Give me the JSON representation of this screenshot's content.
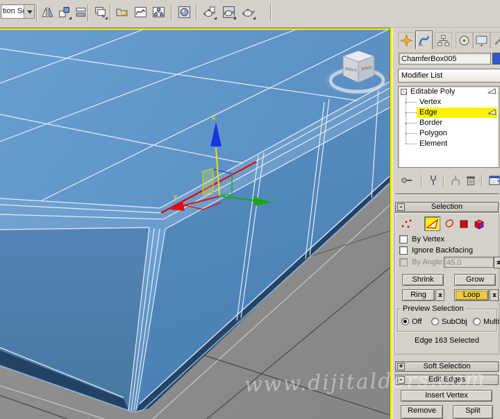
{
  "toolbar": {
    "selection_set_value": "tion Se",
    "icons": [
      {
        "name": "mirror-icon"
      },
      {
        "name": "align-icon"
      },
      {
        "name": "manage-layers-icon"
      },
      {
        "name": "layer-list-icon"
      },
      {
        "name": "scene-explorer-icon"
      },
      {
        "name": "curve-editor-icon"
      },
      {
        "name": "schematic-view-icon"
      },
      {
        "name": "material-editor-icon"
      },
      {
        "name": "render-setup-icon"
      },
      {
        "name": "rendered-frame-window-icon"
      },
      {
        "name": "render-production-icon"
      }
    ]
  },
  "viewport": {
    "watermark": "www.dijitalders.com",
    "axis_labels": {
      "x": "x",
      "y": "y",
      "z": "z"
    },
    "viewcube": {
      "left_face": "RIGHT",
      "right_face": "BACK"
    }
  },
  "command_panel": {
    "tabs": [
      {
        "name": "create-tab"
      },
      {
        "name": "modify-tab"
      },
      {
        "name": "hierarchy-tab"
      },
      {
        "name": "motion-tab"
      },
      {
        "name": "display-tab"
      },
      {
        "name": "utilities-tab"
      }
    ],
    "object_name": "ChamferBox005",
    "object_color": "#2e59cf",
    "modifier_list_label": "Modifier List",
    "modifier_stack": {
      "expand_glyph": "-",
      "items": [
        {
          "label": "Editable Poly"
        },
        {
          "label": "Vertex"
        },
        {
          "label": "Edge"
        },
        {
          "label": "Border"
        },
        {
          "label": "Polygon"
        },
        {
          "label": "Element"
        }
      ]
    },
    "stack_tools": [
      {
        "name": "pin-stack-icon"
      },
      {
        "name": "show-end-result-icon"
      },
      {
        "name": "make-unique-icon"
      },
      {
        "name": "remove-modifier-icon"
      },
      {
        "name": "configure-modifier-sets-icon"
      }
    ],
    "selection": {
      "title": "Selection",
      "collapse": "-",
      "by_vertex": "By Vertex",
      "ignore_backfacing": "Ignore Backfacing",
      "by_angle": "By Angle:",
      "by_angle_value": "45,0",
      "shrink": "Shrink",
      "grow": "Grow",
      "ring": "Ring",
      "loop": "Loop",
      "preview_label": "Preview Selection",
      "off": "Off",
      "subobj": "SubObj",
      "multi": "Multi",
      "status": "Edge 163 Selected"
    },
    "soft_selection": {
      "title": "Soft Selection",
      "collapse": "+"
    },
    "edit_edges": {
      "title": "Edit Edges",
      "collapse": "-",
      "insert_vertex": "Insert Vertex",
      "remove": "Remove",
      "split": "Split"
    }
  }
}
